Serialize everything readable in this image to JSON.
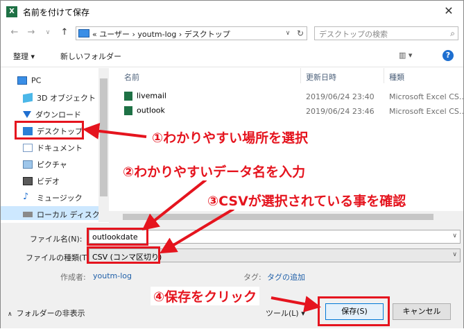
{
  "window": {
    "title": "名前を付けて保存",
    "app_icon": "X",
    "close": "✕"
  },
  "nav": {
    "back": "←",
    "forward": "→",
    "recent": "∨",
    "up": "↑",
    "address": "« ユーザー › youtm-log › デスクトップ",
    "address_dropdown": "∨",
    "refresh": "↻",
    "search_placeholder": "デスクトップの検索",
    "search_icon": "⌕"
  },
  "toolbar": {
    "organize": "整理 ▾",
    "new_folder": "新しいフォルダー",
    "view": "▥ ▾",
    "help": "?"
  },
  "sidebar": {
    "items": [
      {
        "label": "PC",
        "icon": "pc-icon"
      },
      {
        "label": "3D オブジェクト",
        "icon": "3d-objects-icon"
      },
      {
        "label": "ダウンロード",
        "icon": "download-icon"
      },
      {
        "label": "デスクトップ",
        "icon": "desktop-icon"
      },
      {
        "label": "ドキュメント",
        "icon": "documents-icon"
      },
      {
        "label": "ピクチャ",
        "icon": "pictures-icon"
      },
      {
        "label": "ビデオ",
        "icon": "videos-icon"
      },
      {
        "label": "ミュージック",
        "icon": "music-icon"
      },
      {
        "label": "ローカル ディスク (C",
        "icon": "drive-icon"
      }
    ]
  },
  "filelist": {
    "columns": [
      "名前",
      "更新日時",
      "種類"
    ],
    "rows": [
      {
        "name": "livemail",
        "date": "2019/06/24 23:40",
        "type": "Microsoft Excel CS..."
      },
      {
        "name": "outlook",
        "date": "2019/06/24 23:46",
        "type": "Microsoft Excel CS..."
      }
    ]
  },
  "form": {
    "filename_label": "ファイル名(N):",
    "filename_value": "outlookdate",
    "filetype_label": "ファイルの種類(T):",
    "filetype_value": "CSV (コンマ区切り)",
    "author_label": "作成者:",
    "author_value": "youtm-log",
    "tags_label": "タグ:",
    "tags_value": "タグの追加",
    "dropdown": "∨"
  },
  "footer": {
    "hide_folders": "フォルダーの非表示",
    "tools": "ツール(L) ▾",
    "save": "保存(S)",
    "cancel": "キャンセル"
  },
  "annotations": {
    "step1": "①わかりやすい場所を選択",
    "step2": "②わかりやすいデータ名を入力",
    "step3": "③CSVが選択されている事を確認",
    "step4": "④保存をクリック"
  },
  "colors": {
    "annotation_red": "#e5141e",
    "excel_green": "#1e7145",
    "selection_blue": "#cde8ff",
    "help_blue": "#1e6fd0"
  }
}
